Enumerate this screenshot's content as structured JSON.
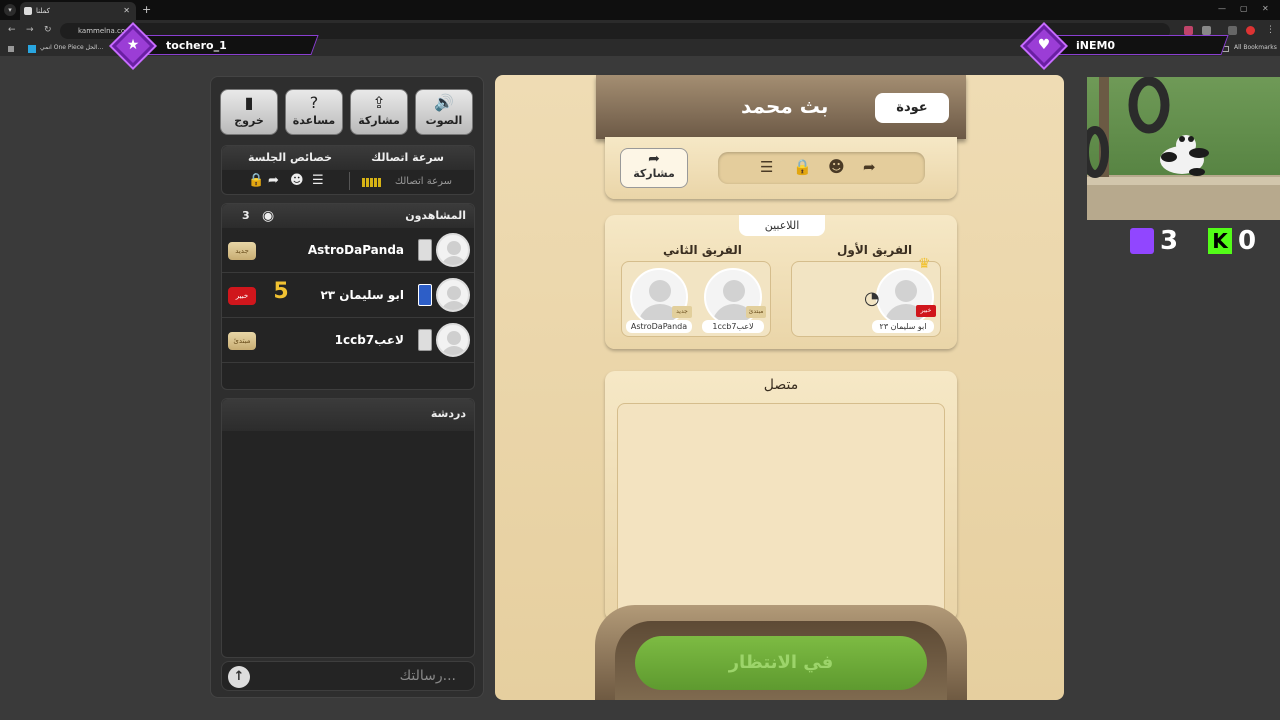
{
  "browser": {
    "tab_title": "كملنا",
    "tab_close": "✕",
    "new_tab": "+",
    "url": "kammelna.com",
    "bookmark_1": "انمي One Piece الحل...",
    "all_bookmarks": "All Bookmarks"
  },
  "overlay": {
    "left_user": "tochero_1",
    "right_user": "iNEM0",
    "score_left": "3",
    "score_right": "0"
  },
  "toolbar": {
    "sound": "الصوت",
    "share": "مشاركة",
    "help": "مساعدة",
    "exit": "خروج"
  },
  "session": {
    "speed_title": "سرعة اتصالك",
    "props_title": "خصائص الجلسة",
    "speed_label": "سرعة اتصالك"
  },
  "viewers": {
    "title": "المشاهدون",
    "count": "3",
    "items": [
      {
        "name": "AstroDaPanda",
        "badge": "جديد"
      },
      {
        "name": "ابو سليمان ٢٣",
        "badge": "خبير"
      },
      {
        "name": "1ccb7لاعب",
        "badge": "مبتدئ"
      }
    ]
  },
  "chat": {
    "title": "دردشة",
    "placeholder": "رسالتك..."
  },
  "game": {
    "title": "بث محمد",
    "back": "عودة",
    "share": "مشاركة",
    "players_label": "اللاعبين",
    "team1": "الفريق الأول",
    "team2": "الفريق الثاني",
    "team1_players": [
      {
        "name": "ابو سليمان ٢٣",
        "badge": "خبير"
      }
    ],
    "team2_players": [
      {
        "name": "1ccb7لاعب",
        "badge": "مبتدئ"
      },
      {
        "name": "AstroDaPanda",
        "badge": "جديد"
      }
    ],
    "online_label": "متصل",
    "waiting": "في الانتظار"
  },
  "colors": {
    "accent_purple": "#9b3dd6",
    "waiting_green": "#6fa83a",
    "twitch": "#9146ff",
    "kick": "#53fc18"
  }
}
